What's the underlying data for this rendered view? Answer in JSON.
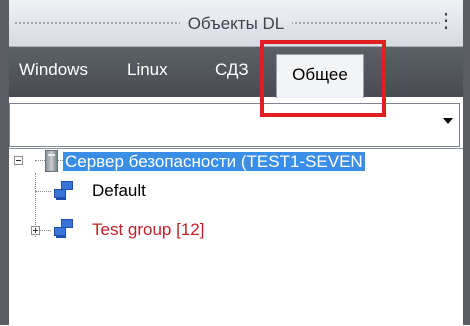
{
  "window": {
    "title": "Объекты DL",
    "menu_glyph": "⋮"
  },
  "tabs": [
    {
      "label": "Windows",
      "active": false
    },
    {
      "label": "Linux",
      "active": false
    },
    {
      "label": "СДЗ",
      "active": false
    },
    {
      "label": "Общее",
      "active": true
    }
  ],
  "dropdown": {
    "value": ""
  },
  "tree": {
    "root": {
      "label": "Сервер безопасности (TEST1-SEVEN",
      "icon": "server-icon",
      "selected": true
    },
    "children": [
      {
        "label": "Default",
        "icon": "computers-icon"
      },
      {
        "label": "Test group [12]",
        "icon": "computers-icon",
        "collapsed": true
      }
    ]
  },
  "colors": {
    "tab_bar": "#50545a",
    "selection": "#3a8ee6",
    "highlight_box": "#e02020",
    "group_text": "#c0202a"
  }
}
